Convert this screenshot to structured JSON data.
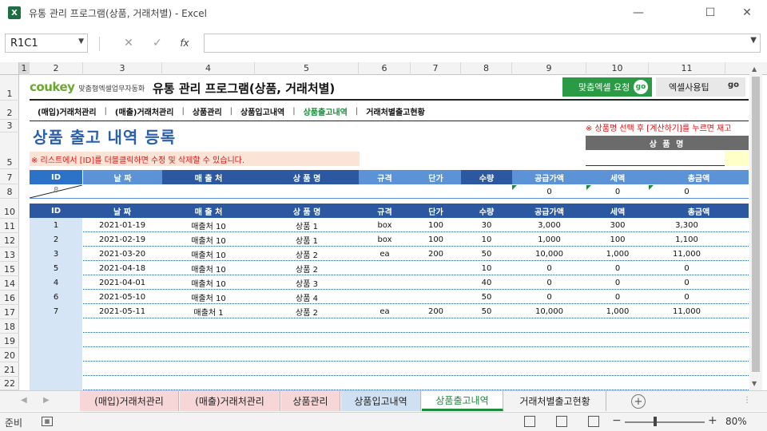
{
  "window": {
    "app_icon": "X",
    "title": "유통 관리 프로그램(상품, 거래처별) - Excel",
    "minimize": "—",
    "maximize": "☐",
    "close": "✕"
  },
  "formula_bar": {
    "name_box": "R1C1",
    "cancel": "✕",
    "enter": "✓",
    "fx": "fx",
    "formula": ""
  },
  "columns": [
    "1",
    "2",
    "3",
    "4",
    "5",
    "6",
    "7",
    "8",
    "9",
    "10",
    "11"
  ],
  "rows": [
    "1",
    "2",
    "3",
    "5",
    "7",
    "8",
    "10",
    "11",
    "12",
    "13",
    "15",
    "14",
    "16",
    "17",
    "18",
    "19",
    "20",
    "21",
    "22"
  ],
  "header": {
    "logo": "coukey",
    "logo_tag": "맞춤형엑셀업무자동화",
    "title": "유통 관리 프로그램(상품, 거래처별)",
    "btn_custom": "맞춤엑셀 요청",
    "btn_custom_go": "go",
    "btn_tips": "엑셀사용팁",
    "btn_tips_go": "go"
  },
  "nav": [
    {
      "label": "(매입)거래처관리",
      "active": false
    },
    {
      "label": "(매출)거래처관리",
      "active": false
    },
    {
      "label": "상품관리",
      "active": false
    },
    {
      "label": "상품입고내역",
      "active": false
    },
    {
      "label": "상품출고내역",
      "active": true
    },
    {
      "label": "거래처별출고현황",
      "active": false
    }
  ],
  "nav_sep": "|",
  "section": {
    "title": "상품 출고 내역 등록",
    "notice": "※ 리스트에서 [ID]를 더블클릭하면 수정 및 삭제할 수 있습니다.",
    "calc_note": "※ 상품명 선택 후 [계산하기]를 누르면 재고",
    "product_label": "상 품 명"
  },
  "input_form": {
    "headers": [
      "ID",
      "날 짜",
      "매 출 처",
      "상 품 명",
      "규격",
      "단가",
      "수량",
      "공급가액",
      "세액",
      "총금액"
    ],
    "id_value": "8",
    "supply": "0",
    "tax": "0",
    "total": "0"
  },
  "list": {
    "headers": [
      "ID",
      "날 짜",
      "매 출 처",
      "상 품 명",
      "규격",
      "단가",
      "수량",
      "공급가액",
      "세액",
      "총금액"
    ],
    "rows": [
      [
        "1",
        "2021-01-19",
        "매출처 10",
        "상품 1",
        "box",
        "100",
        "30",
        "3,000",
        "300",
        "3,300"
      ],
      [
        "2",
        "2021-02-19",
        "매출처 10",
        "상품 1",
        "box",
        "100",
        "10",
        "1,000",
        "100",
        "1,100"
      ],
      [
        "3",
        "2021-03-20",
        "매출처 10",
        "상품 2",
        "ea",
        "200",
        "50",
        "10,000",
        "1,000",
        "11,000"
      ],
      [
        "5",
        "2021-04-18",
        "매출처 10",
        "상품 2",
        "",
        "",
        "10",
        "0",
        "0",
        "0"
      ],
      [
        "4",
        "2021-04-01",
        "매출처 10",
        "상품 3",
        "",
        "",
        "40",
        "0",
        "0",
        "0"
      ],
      [
        "6",
        "2021-05-10",
        "매출처 10",
        "상품 4",
        "",
        "",
        "50",
        "0",
        "0",
        "0"
      ],
      [
        "7",
        "2021-05-11",
        "매출처 1",
        "상품 2",
        "ea",
        "200",
        "50",
        "10,000",
        "1,000",
        "11,000"
      ]
    ]
  },
  "tabs": [
    {
      "label": "(매입)거래처관리",
      "color": "#f6d6d6"
    },
    {
      "label": "(매출)거래처관리",
      "color": "#f6d6d6"
    },
    {
      "label": "상품관리",
      "color": "#f6d6d6"
    },
    {
      "label": "상품입고내역",
      "color": "#cfe0f3"
    },
    {
      "label": "상품출고내역",
      "color": "#ffffff",
      "active": true
    },
    {
      "label": "거래처별출고현황",
      "color": "#f3f3f3"
    }
  ],
  "add_sheet": "+",
  "status": {
    "ready": "준비",
    "zoom": "80%",
    "zoom_minus": "−",
    "zoom_plus": "+"
  },
  "colors": {
    "brand_green": "#2a9a45",
    "header_blue": "#2b58a0",
    "title_blue": "#2b5fae",
    "notice_red": "#d11111"
  }
}
